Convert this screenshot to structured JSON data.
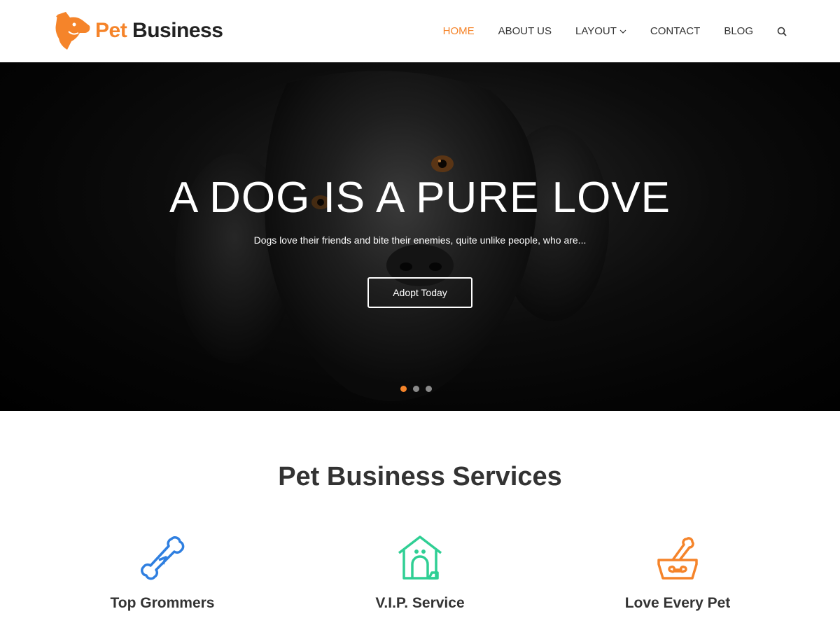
{
  "brand": {
    "name_part1": "Pet",
    "name_part2": "Business",
    "accent": "#f5842a"
  },
  "nav": {
    "items": [
      {
        "label": "HOME",
        "active": true
      },
      {
        "label": "ABOUT US",
        "active": false
      },
      {
        "label": "LAYOUT",
        "active": false,
        "dropdown": true
      },
      {
        "label": "CONTACT",
        "active": false
      },
      {
        "label": "BLOG",
        "active": false
      }
    ],
    "search_icon": "search-icon"
  },
  "hero": {
    "title": "A DOG IS A PURE LOVE",
    "subtitle": "Dogs love their friends and bite their enemies, quite unlike people, who are...",
    "button_label": "Adopt Today",
    "slides": 3,
    "active_slide": 1
  },
  "services": {
    "title": "Pet Business Services",
    "items": [
      {
        "label": "Top Grommers",
        "icon": "bone-icon",
        "color": "#2f7fe0"
      },
      {
        "label": "V.I.P. Service",
        "icon": "doghouse-icon",
        "color": "#2fcf94"
      },
      {
        "label": "Love Every Pet",
        "icon": "pet-bowl-icon",
        "color": "#f5842a"
      }
    ]
  }
}
